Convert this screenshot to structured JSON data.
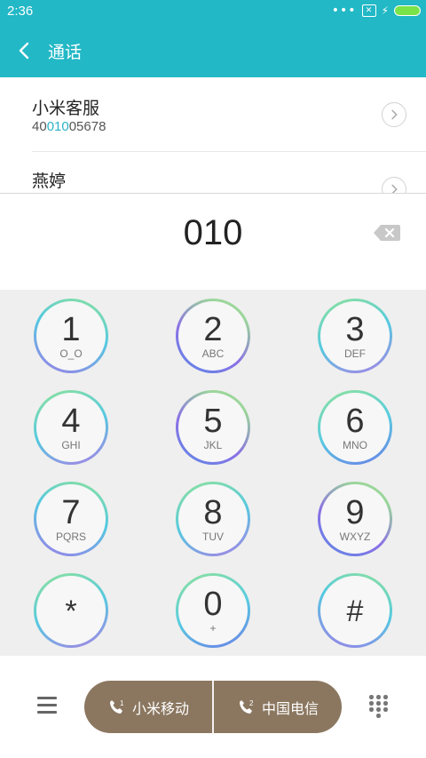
{
  "status": {
    "time": "2:36",
    "dots": "•••"
  },
  "header": {
    "title": "通话"
  },
  "contacts": [
    {
      "name": "小米客服",
      "number_pre": "40",
      "number_match": "010",
      "number_post": "05678"
    },
    {
      "name": "燕婷"
    }
  ],
  "dialed": "010",
  "keys": [
    {
      "digit": "1",
      "letters": "O_O"
    },
    {
      "digit": "2",
      "letters": "ABC"
    },
    {
      "digit": "3",
      "letters": "DEF"
    },
    {
      "digit": "4",
      "letters": "GHI"
    },
    {
      "digit": "5",
      "letters": "JKL"
    },
    {
      "digit": "6",
      "letters": "MNO"
    },
    {
      "digit": "7",
      "letters": "PQRS"
    },
    {
      "digit": "8",
      "letters": "TUV"
    },
    {
      "digit": "9",
      "letters": "WXYZ"
    },
    {
      "digit": "*",
      "letters": ""
    },
    {
      "digit": "0",
      "letters": "+"
    },
    {
      "digit": "#",
      "letters": ""
    }
  ],
  "call": {
    "sim1": {
      "index": "1",
      "label": "小米移动"
    },
    "sim2": {
      "index": "2",
      "label": "中国电信"
    }
  },
  "colors": {
    "header_bg": "#22b8c6",
    "call_button_bg": "#8b7760",
    "match_highlight": "#2cb3c6",
    "battery": "#7ae34a"
  },
  "icons": [
    "back-icon",
    "backspace-icon",
    "menu-icon",
    "phone-icon",
    "keypad-icon",
    "chevron-right-icon",
    "battery-icon",
    "sim-off-icon",
    "charging-icon"
  ]
}
